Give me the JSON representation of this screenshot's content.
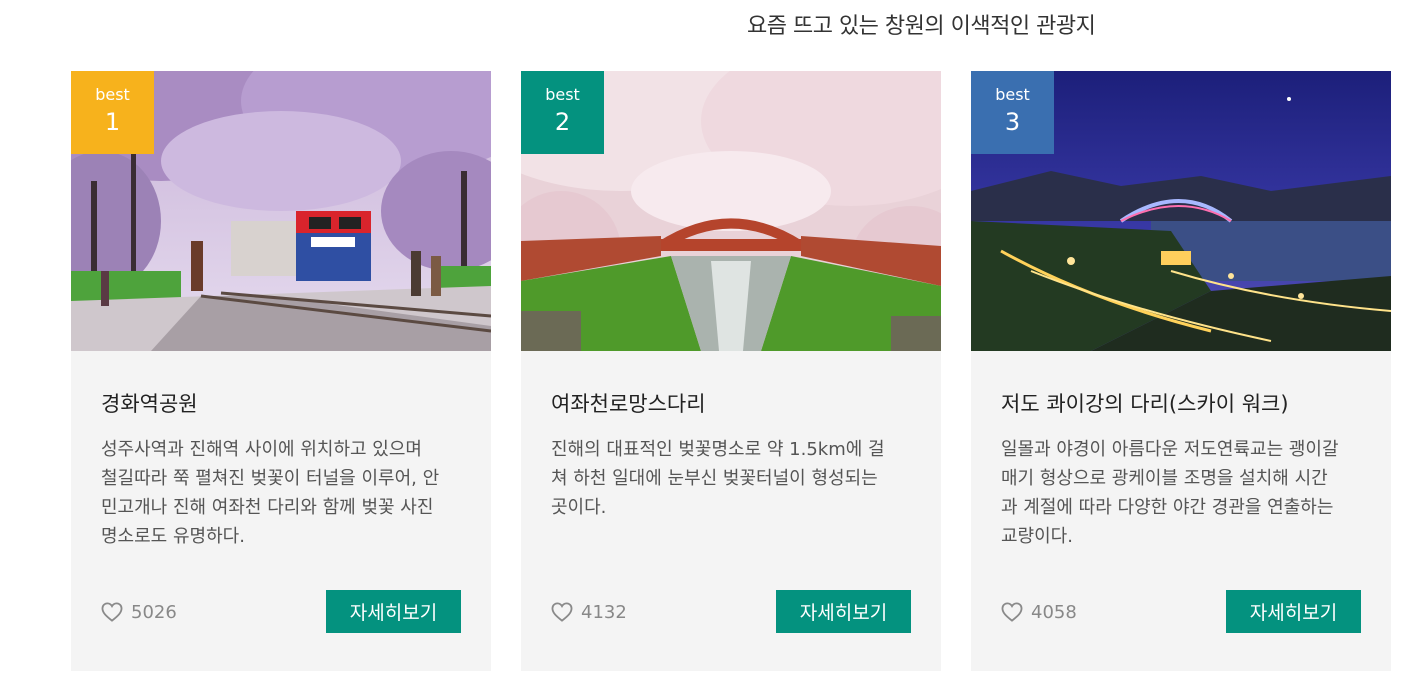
{
  "section": {
    "title": "요즘 뜨고 있는 창원의 이색적인 관광지"
  },
  "colors": {
    "card_bg": "#f4f4f4",
    "button_bg": "#04927f",
    "badge_1": "#f7b21c",
    "badge_2": "#04927f",
    "badge_3": "#3a6fb0"
  },
  "cards": [
    {
      "badge_label": "best",
      "rank": "1",
      "image": "cherry-blossom-train-photo",
      "title": "경화역공원",
      "description": "성주사역과 진해역 사이에 위치하고 있으며 철길따라 쭉 펼쳐진 벚꽃이 터널을 이루어, 안민고개나 진해 여좌천 다리와 함께 벚꽃 사진명소로도 유명하다.",
      "likes": "5026",
      "button_label": "자세히보기"
    },
    {
      "badge_label": "best",
      "rank": "2",
      "image": "cherry-blossom-bridge-stream-photo",
      "title": "여좌천로망스다리",
      "description": "진해의 대표적인 벚꽃명소로 약 1.5km에 걸쳐 하천 일대에 눈부신 벚꽃터널이 형성되는 곳이다.",
      "likes": "4132",
      "button_label": "자세히보기"
    },
    {
      "badge_label": "best",
      "rank": "3",
      "image": "night-bridge-skywalk-photo",
      "title": "저도 콰이강의 다리(스카이 워크)",
      "description": "일몰과 야경이 아름다운 저도연륙교는 괭이갈매기 형상으로 광케이블 조명을 설치해 시간과 계절에 따라 다양한 야간 경관을 연출하는 교량이다.",
      "likes": "4058",
      "button_label": "자세히보기"
    }
  ]
}
